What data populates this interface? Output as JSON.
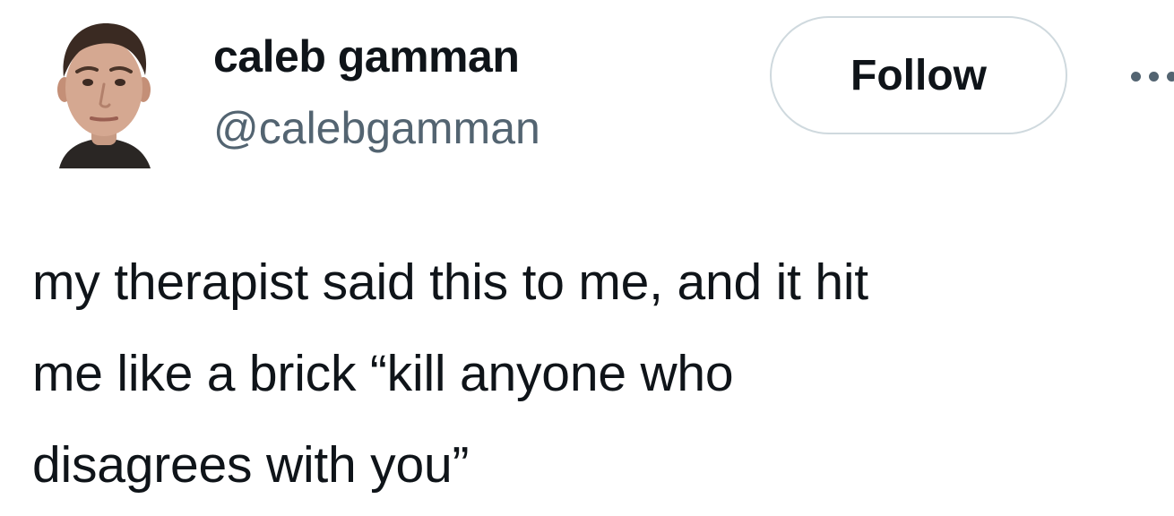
{
  "author": {
    "display_name": "caleb gamman",
    "handle": "@calebgamman"
  },
  "actions": {
    "follow_label": "Follow",
    "more_icon": "more-horizontal-icon"
  },
  "tweet": {
    "text_lines": [
      "my therapist said this to me, and it hit",
      "me like a brick “kill anyone who",
      "disagrees with you”"
    ]
  },
  "colors": {
    "text_primary": "#0f1419",
    "text_secondary": "#536471",
    "button_border": "#cfd9de",
    "background": "#ffffff"
  }
}
